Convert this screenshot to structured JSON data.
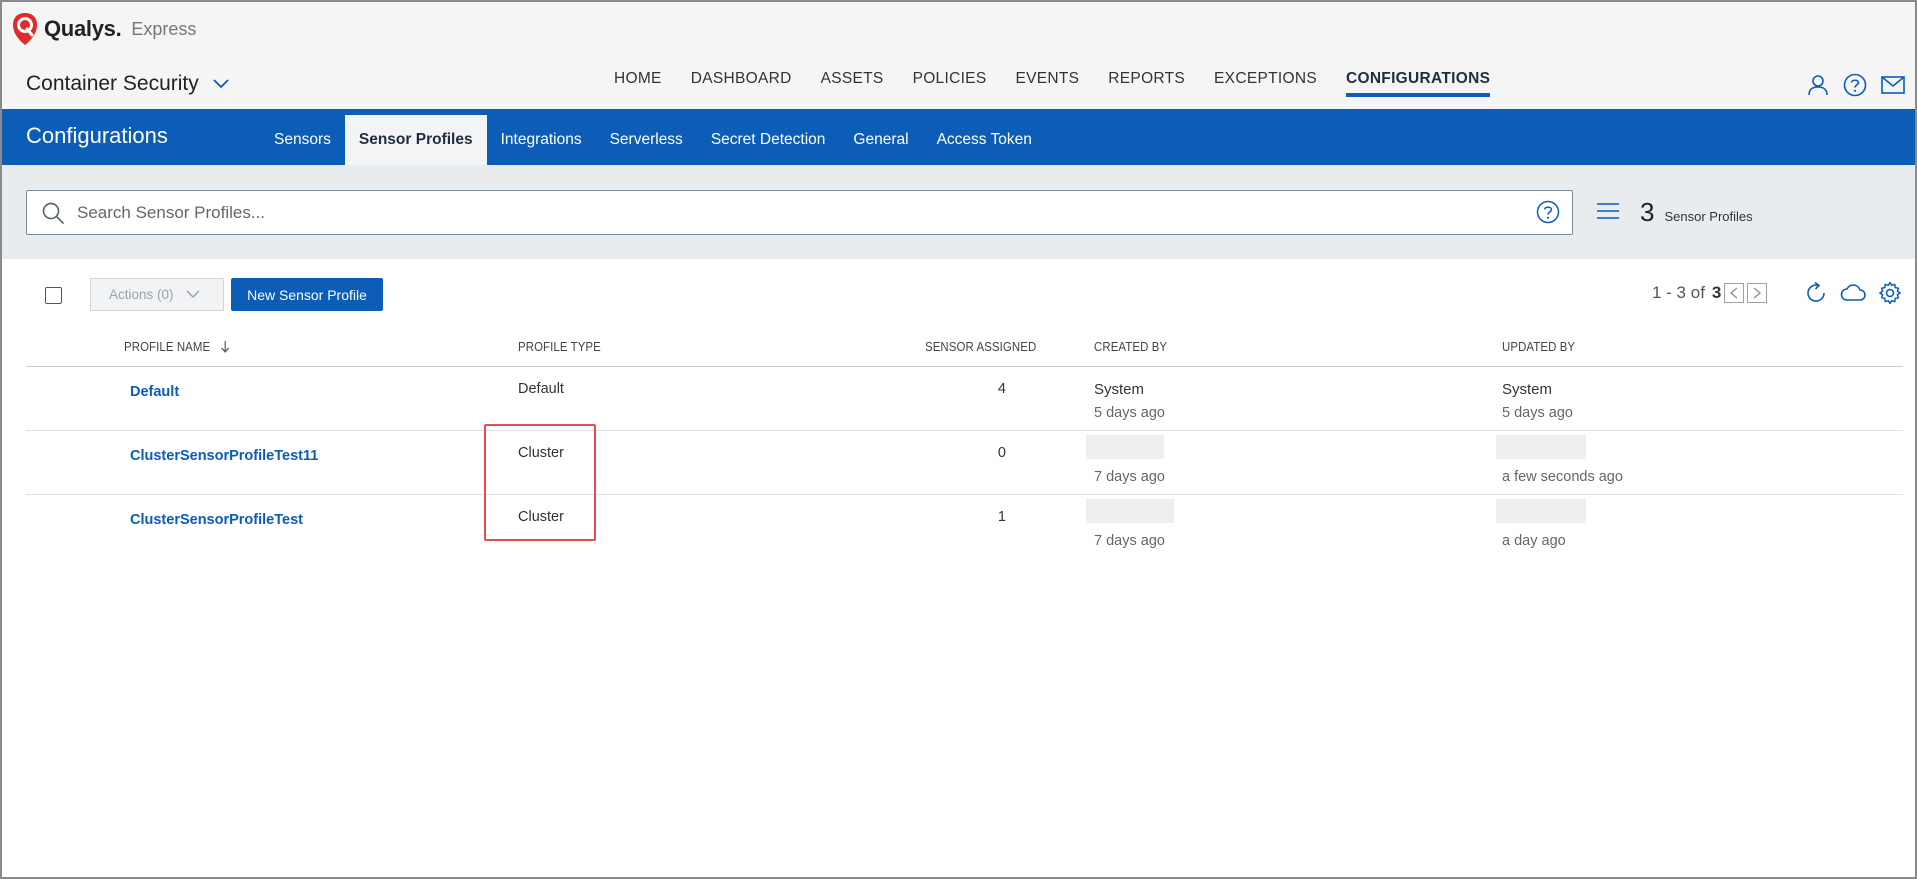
{
  "brand": {
    "name": "Qualys.",
    "product": "Express"
  },
  "module": {
    "name": "Container Security"
  },
  "main_nav": [
    {
      "label": "HOME",
      "active": false
    },
    {
      "label": "DASHBOARD",
      "active": false
    },
    {
      "label": "ASSETS",
      "active": false
    },
    {
      "label": "POLICIES",
      "active": false
    },
    {
      "label": "EVENTS",
      "active": false
    },
    {
      "label": "REPORTS",
      "active": false
    },
    {
      "label": "EXCEPTIONS",
      "active": false
    },
    {
      "label": "CONFIGURATIONS",
      "active": true
    }
  ],
  "config": {
    "title": "Configurations",
    "tabs": [
      {
        "label": "Sensors",
        "active": false
      },
      {
        "label": "Sensor Profiles",
        "active": true
      },
      {
        "label": "Integrations",
        "active": false
      },
      {
        "label": "Serverless",
        "active": false
      },
      {
        "label": "Secret Detection",
        "active": false
      },
      {
        "label": "General",
        "active": false
      },
      {
        "label": "Access Token",
        "active": false
      }
    ]
  },
  "search": {
    "placeholder": "Search Sensor Profiles...",
    "value": ""
  },
  "summary": {
    "count": "3",
    "label": "Sensor Profiles"
  },
  "toolbar": {
    "actions_label": "Actions (0)",
    "new_label": "New Sensor Profile"
  },
  "paging": {
    "range": "1 - 3 of",
    "total": "3"
  },
  "table": {
    "headers": {
      "name": "PROFILE NAME",
      "type": "PROFILE TYPE",
      "assigned": "SENSOR ASSIGNED",
      "created": "CREATED BY",
      "updated": "UPDATED BY"
    },
    "rows": [
      {
        "name": "Default",
        "type": "Default",
        "assigned": "4",
        "created_by": "System",
        "created_when": "5 days ago",
        "updated_by": "System",
        "updated_when": "5 days ago"
      },
      {
        "name": "ClusterSensorProfileTest11",
        "type": "Cluster",
        "assigned": "0",
        "created_by": "",
        "created_when": "7 days ago",
        "updated_by": "",
        "updated_when": "a few seconds ago"
      },
      {
        "name": "ClusterSensorProfileTest",
        "type": "Cluster",
        "assigned": "1",
        "created_by": "",
        "created_when": "7 days ago",
        "updated_by": "",
        "updated_when": "a day ago"
      }
    ]
  },
  "colors": {
    "accent": "#0b5db8",
    "highlight": "#e84c4c"
  }
}
